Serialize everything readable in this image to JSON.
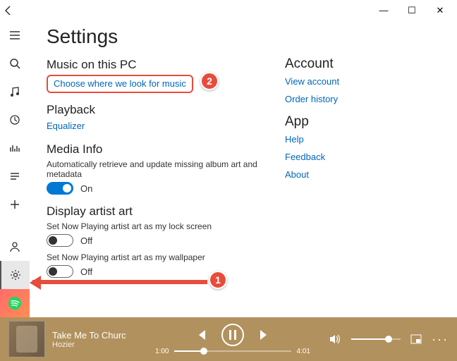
{
  "window": {
    "minimize": "—",
    "maximize": "☐",
    "close": "✕"
  },
  "page_title": "Settings",
  "sections": {
    "music_on_pc": {
      "heading": "Music on this PC",
      "link": "Choose where we look for music"
    },
    "playback": {
      "heading": "Playback",
      "link": "Equalizer"
    },
    "media_info": {
      "heading": "Media Info",
      "desc": "Automatically retrieve and update missing album art and metadata",
      "state": "On"
    },
    "artist_art": {
      "heading": "Display artist art",
      "opt1_desc": "Set Now Playing artist art as my lock screen",
      "opt1_state": "Off",
      "opt2_desc": "Set Now Playing artist art as my wallpaper",
      "opt2_state": "Off"
    }
  },
  "right": {
    "account": {
      "heading": "Account",
      "link1": "View account",
      "link2": "Order history"
    },
    "app": {
      "heading": "App",
      "link1": "Help",
      "link2": "Feedback",
      "link3": "About"
    }
  },
  "callouts": {
    "one": "1",
    "two": "2"
  },
  "player": {
    "track": "Take Me To Churc",
    "artist": "Hozier",
    "elapsed": "1:00",
    "total": "4:01"
  }
}
